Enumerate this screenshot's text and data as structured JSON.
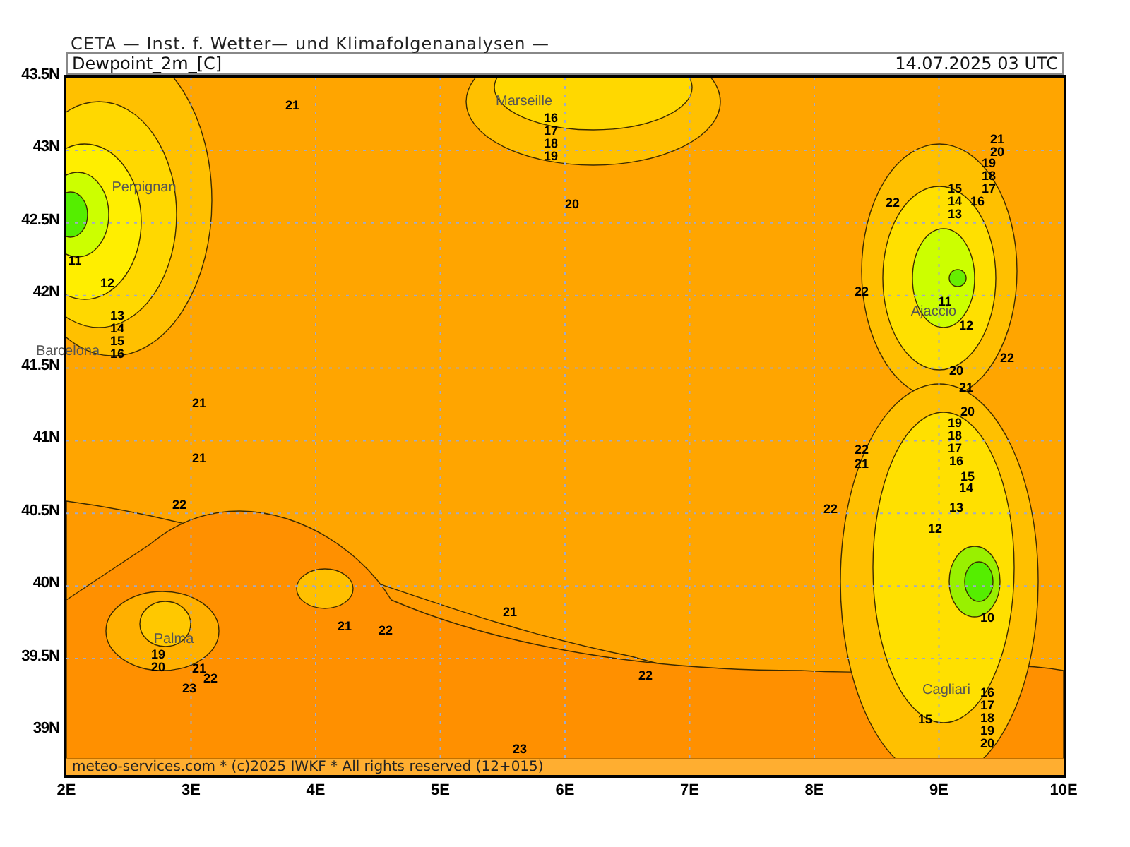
{
  "header": {
    "title": "CETA — Inst. f. Wetter— und Klimafolgenanalysen —",
    "field": "Dewpoint_2m_[C]",
    "valid_time": "14.07.2025 03 UTC"
  },
  "map": {
    "lat_ticks": [
      "43.5N",
      "43N",
      "42.5N",
      "42N",
      "41.5N",
      "41N",
      "40.5N",
      "40N",
      "39.5N",
      "39N"
    ],
    "lon_ticks": [
      "2E",
      "3E",
      "4E",
      "5E",
      "6E",
      "7E",
      "8E",
      "9E",
      "10E"
    ],
    "cities": [
      "Marseille",
      "Perpignan",
      "Barcelona",
      "Palma",
      "Ajaccio",
      "Cagliari"
    ],
    "contour_labels": [
      "21",
      "16",
      "17",
      "18",
      "19",
      "20",
      "11",
      "12",
      "13",
      "14",
      "15",
      "16",
      "21",
      "21",
      "22",
      "19",
      "20",
      "21",
      "22",
      "23",
      "21",
      "22",
      "21",
      "22",
      "23",
      "21",
      "20",
      "19",
      "18",
      "17",
      "16",
      "15",
      "14",
      "13",
      "22",
      "22",
      "11",
      "12",
      "22",
      "20",
      "21",
      "20",
      "19",
      "18",
      "17",
      "16",
      "22",
      "21",
      "15",
      "14",
      "22",
      "13",
      "12",
      "10",
      "15",
      "16",
      "17",
      "18",
      "19",
      "20"
    ],
    "credit": "meteo-services.com * (c)2025 IWKF * All rights reserved (12+015)"
  }
}
